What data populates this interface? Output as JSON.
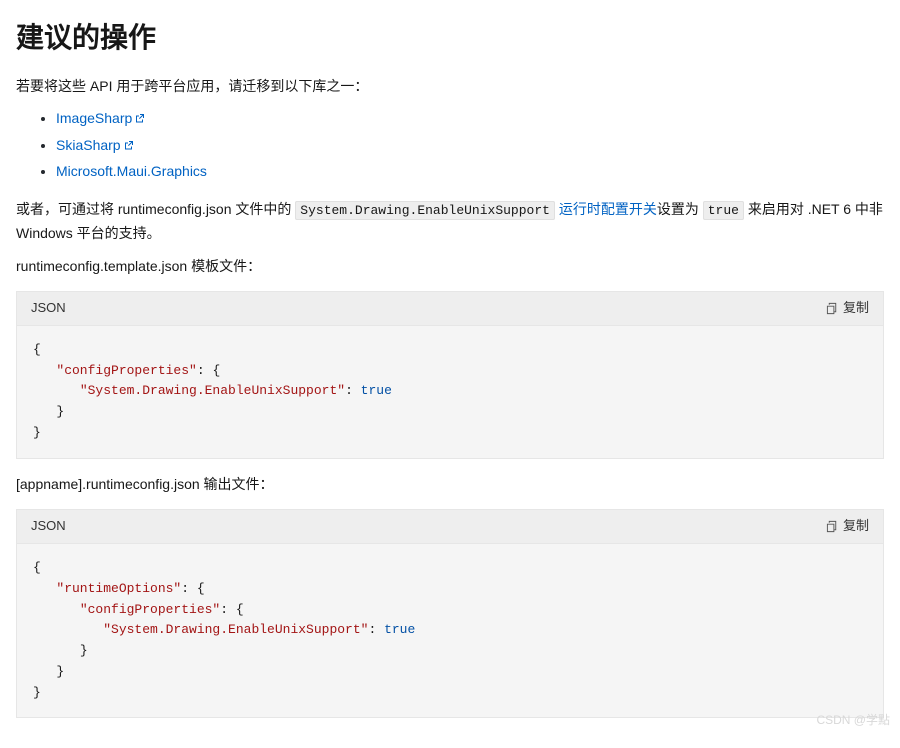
{
  "heading": "建议的操作",
  "intro_p": "若要将这些 API 用于跨平台应用，请迁移到以下库之一：",
  "links": [
    {
      "label": "ImageSharp",
      "external": true
    },
    {
      "label": "SkiaSharp",
      "external": true
    },
    {
      "label": "Microsoft.Maui.Graphics",
      "external": false
    }
  ],
  "para2": {
    "prefix": "或者，可通过将 runtimeconfig.json 文件中的 ",
    "code1": "System.Drawing.EnableUnixSupport",
    "link_text": " 运行时配置开关",
    "mid": "设置为 ",
    "code2": "true",
    "suffix": " 来启用对 .NET 6 中非 Windows 平台的支持。"
  },
  "block1_caption": "runtimeconfig.template.json 模板文件：",
  "block2_caption": "[appname].runtimeconfig.json 输出文件：",
  "code_lang_label": "JSON",
  "copy_label": "复制",
  "code1": {
    "key1": "\"configProperties\"",
    "key2": "\"System.Drawing.EnableUnixSupport\"",
    "val": "true"
  },
  "code2": {
    "key1": "\"runtimeOptions\"",
    "key2": "\"configProperties\"",
    "key3": "\"System.Drawing.EnableUnixSupport\"",
    "val": "true"
  },
  "watermark": "CSDN @学點"
}
